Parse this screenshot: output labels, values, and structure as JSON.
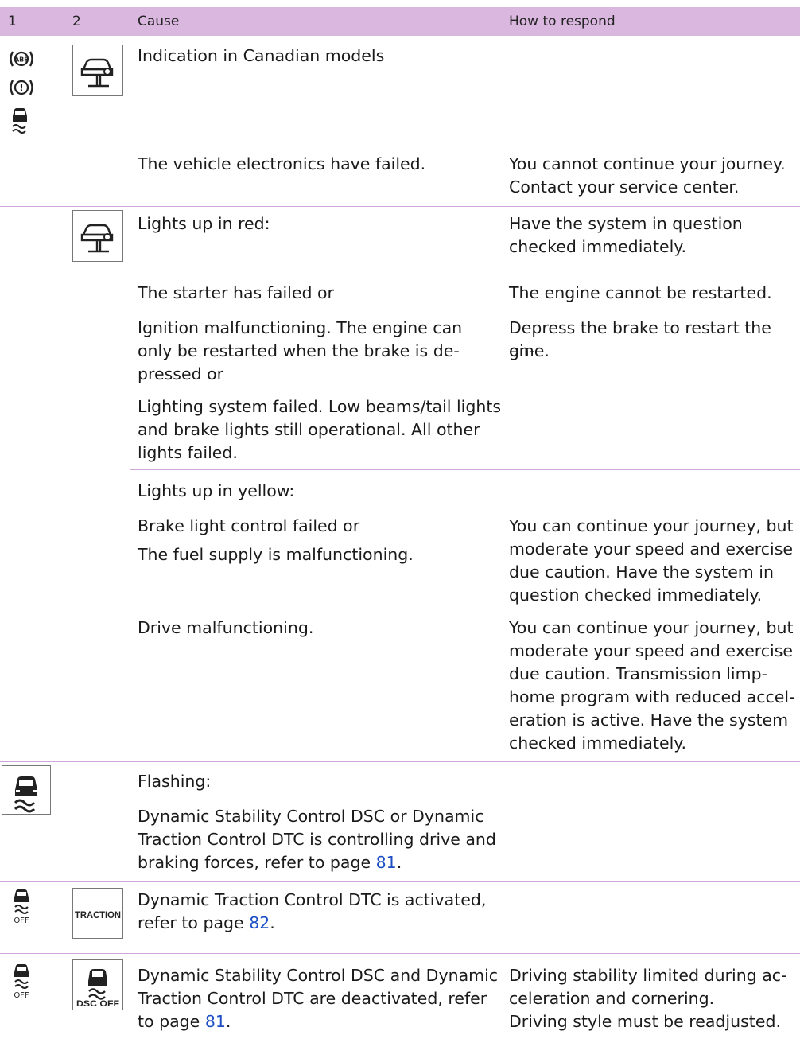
{
  "header": {
    "col1": "1",
    "col2": "2",
    "col3": "Cause",
    "col4": "How to respond"
  },
  "rows": {
    "r1": {
      "cause_head": "Indication in Canadian models",
      "cause": "The vehicle electronics have failed.",
      "respond_1": "You cannot continue your journey.",
      "respond_2": "Contact your service center."
    },
    "r2": {
      "red_head": "Lights up in red:",
      "red_resp_1": "Have the system in question",
      "red_resp_2": "checked immediately.",
      "starter": "The starter has failed or",
      "starter_resp": "The engine cannot be restarted.",
      "ign_1": "Ignition malfunctioning. The engine can",
      "ign_2": "only be restarted when the brake is de-",
      "ign_3": "pressed or",
      "ign_resp_1": "Depress the brake to restart the en-",
      "ign_resp_2": "gine.",
      "light_1": "Lighting system failed. Low beams/tail lights",
      "light_2": "and brake lights still operational. All other",
      "light_3": "lights failed.",
      "yellow_head": "Lights up in yellow:",
      "brake": "Brake light control failed or",
      "fuel": "The fuel supply is malfunctioning.",
      "yr_1": "You can continue your journey, but",
      "yr_2": "moderate your speed and exercise",
      "yr_3": "due caution. Have the system in",
      "yr_4": "question checked immediately.",
      "drive": "Drive malfunctioning.",
      "dr_1": "You can continue your journey, but",
      "dr_2": "moderate your speed and exercise",
      "dr_3": "due caution. Transmission limp-",
      "dr_4": "home program with reduced accel-",
      "dr_5": "eration is active. Have the system",
      "dr_6": "checked immediately."
    },
    "r3": {
      "head": "Flashing:",
      "l1": "Dynamic Stability Control DSC or Dynamic",
      "l2": "Traction Control DTC is controlling drive and",
      "l3_pre": "braking forces, refer to page ",
      "l3_link": "81",
      "l3_post": "."
    },
    "r4": {
      "l1": "Dynamic Traction Control DTC is activated,",
      "l2_pre": "refer to page ",
      "l2_link": "82",
      "l2_post": ".",
      "icon_text": "TRACTION",
      "off_text": "OFF"
    },
    "r5": {
      "l1": "Dynamic Stability Control DSC and Dynamic",
      "l2": "Traction Control DTC are deactivated, refer",
      "l3_pre": "to page ",
      "l3_link": "81",
      "l3_post": ".",
      "resp_1": "Driving stability limited during ac-",
      "resp_2": "celeration and cornering.",
      "resp_3": "Driving style must be readjusted.",
      "off_text": "OFF",
      "dscoff_text": "DSC OFF"
    }
  },
  "icons": {
    "abs_text": "ABS",
    "warn_text": "!"
  }
}
